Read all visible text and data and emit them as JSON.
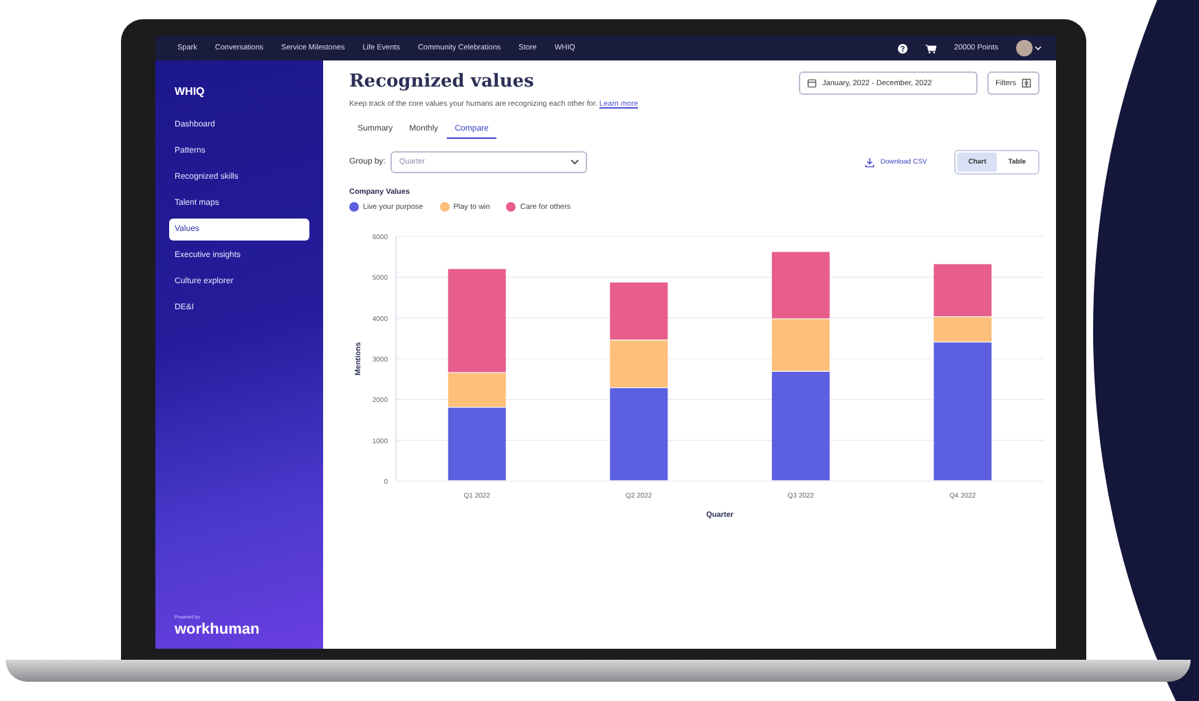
{
  "top_nav": {
    "links": [
      "Spark",
      "Conversations",
      "Service Milestones",
      "Life Events",
      "Community Celebrations",
      "Store",
      "WHIQ"
    ],
    "points": "20000 Points"
  },
  "sidebar": {
    "title": "WHIQ",
    "items": [
      {
        "label": "Dashboard",
        "selected": false
      },
      {
        "label": "Patterns",
        "selected": false
      },
      {
        "label": "Recognized skills",
        "selected": false
      },
      {
        "label": "Talent maps",
        "selected": false
      },
      {
        "label": "Values",
        "selected": true
      },
      {
        "label": "Executive insights",
        "selected": false
      },
      {
        "label": "Culture explorer",
        "selected": false
      },
      {
        "label": "DE&I",
        "selected": false
      }
    ],
    "powered_by": "Powered by",
    "brand": "workhuman"
  },
  "header": {
    "title": "Recognized values",
    "subtitle": "Keep track of the core values your humans are recognizing each other for.",
    "link": "Learn more",
    "date_range": "January, 2022 - December, 2022",
    "filters": "Filters"
  },
  "tabs": [
    {
      "label": "Summary",
      "selected": false
    },
    {
      "label": "Monthly",
      "selected": false
    },
    {
      "label": "Compare",
      "selected": true
    }
  ],
  "group_by": {
    "label": "Group by:",
    "value": "Quarter"
  },
  "download": "Download CSV",
  "view_toggle": [
    {
      "label": "Chart",
      "selected": true
    },
    {
      "label": "Table",
      "selected": false
    }
  ],
  "chart": {
    "title": "Company Values",
    "chart_data": {
      "type": "bar",
      "stacked": true,
      "grid": true,
      "xlabel": "Quarter",
      "ylabel": "Mentions",
      "categories": [
        "Q1 2022",
        "Q2 2022",
        "Q3 2022",
        "Q4 2022"
      ],
      "ylim": [
        0,
        6000
      ],
      "yticks": [
        0,
        1000,
        2000,
        3000,
        4000,
        5000,
        6000
      ],
      "series": [
        {
          "name": "Live your purpose",
          "color": "#5b5fe0",
          "values": [
            1800,
            2280,
            2680,
            3400
          ]
        },
        {
          "name": "Play to win",
          "color": "#fdbf7a",
          "values": [
            850,
            1170,
            1290,
            620
          ]
        },
        {
          "name": "Care for others",
          "color": "#e75d8c",
          "values": [
            2550,
            1420,
            1650,
            1300
          ]
        }
      ]
    }
  }
}
